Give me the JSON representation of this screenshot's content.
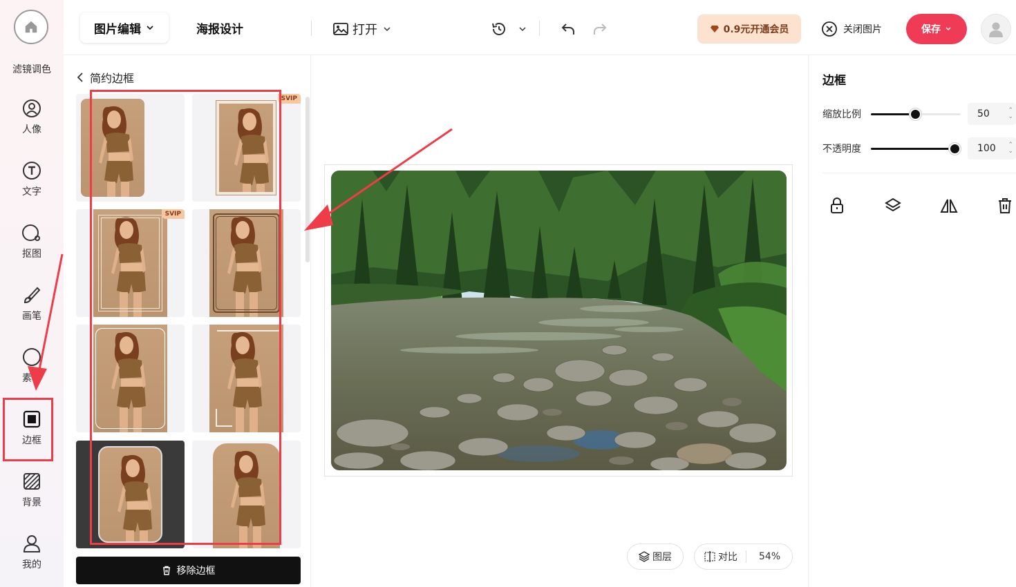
{
  "leftnav": {
    "filter_label": "滤镜调色",
    "items": [
      {
        "label": "人像",
        "icon": "portrait-icon"
      },
      {
        "label": "文字",
        "icon": "text-icon"
      },
      {
        "label": "抠图",
        "icon": "cutout-icon"
      },
      {
        "label": "画笔",
        "icon": "brush-icon"
      },
      {
        "label": "素材",
        "icon": "material-icon"
      },
      {
        "label": "边框",
        "icon": "frame-icon"
      },
      {
        "label": "背景",
        "icon": "background-icon"
      },
      {
        "label": "我的",
        "icon": "user-icon"
      }
    ],
    "active": "边框"
  },
  "topbar": {
    "tab_edit": "图片编辑",
    "tab_poster": "海报设计",
    "open_label": "打开",
    "vip_label": "0.9元开通会员",
    "close_label": "关闭图片",
    "save_label": "保存"
  },
  "panel": {
    "title": "简约边框",
    "svip_badge": "SVIP",
    "remove_label": "移除边框",
    "frames": [
      {
        "style": "rounded"
      },
      {
        "style": "white-border",
        "svip": true
      },
      {
        "style": "thin-inset",
        "svip": true
      },
      {
        "style": "dark-inset"
      },
      {
        "style": "ornate-corners"
      },
      {
        "style": "offset-lines"
      },
      {
        "style": "dark-mat"
      },
      {
        "style": "arch"
      }
    ]
  },
  "canvas": {
    "layers_label": "图层",
    "compare_label": "对比",
    "zoom": "54%"
  },
  "rpanel": {
    "title": "边框",
    "scale_label": "缩放比例",
    "scale_value": "50",
    "opacity_label": "不透明度",
    "opacity_value": "100"
  },
  "colors": {
    "accent": "#f03b57",
    "annotation": "#ee3d48",
    "vip_bg": "#fde2cf"
  }
}
